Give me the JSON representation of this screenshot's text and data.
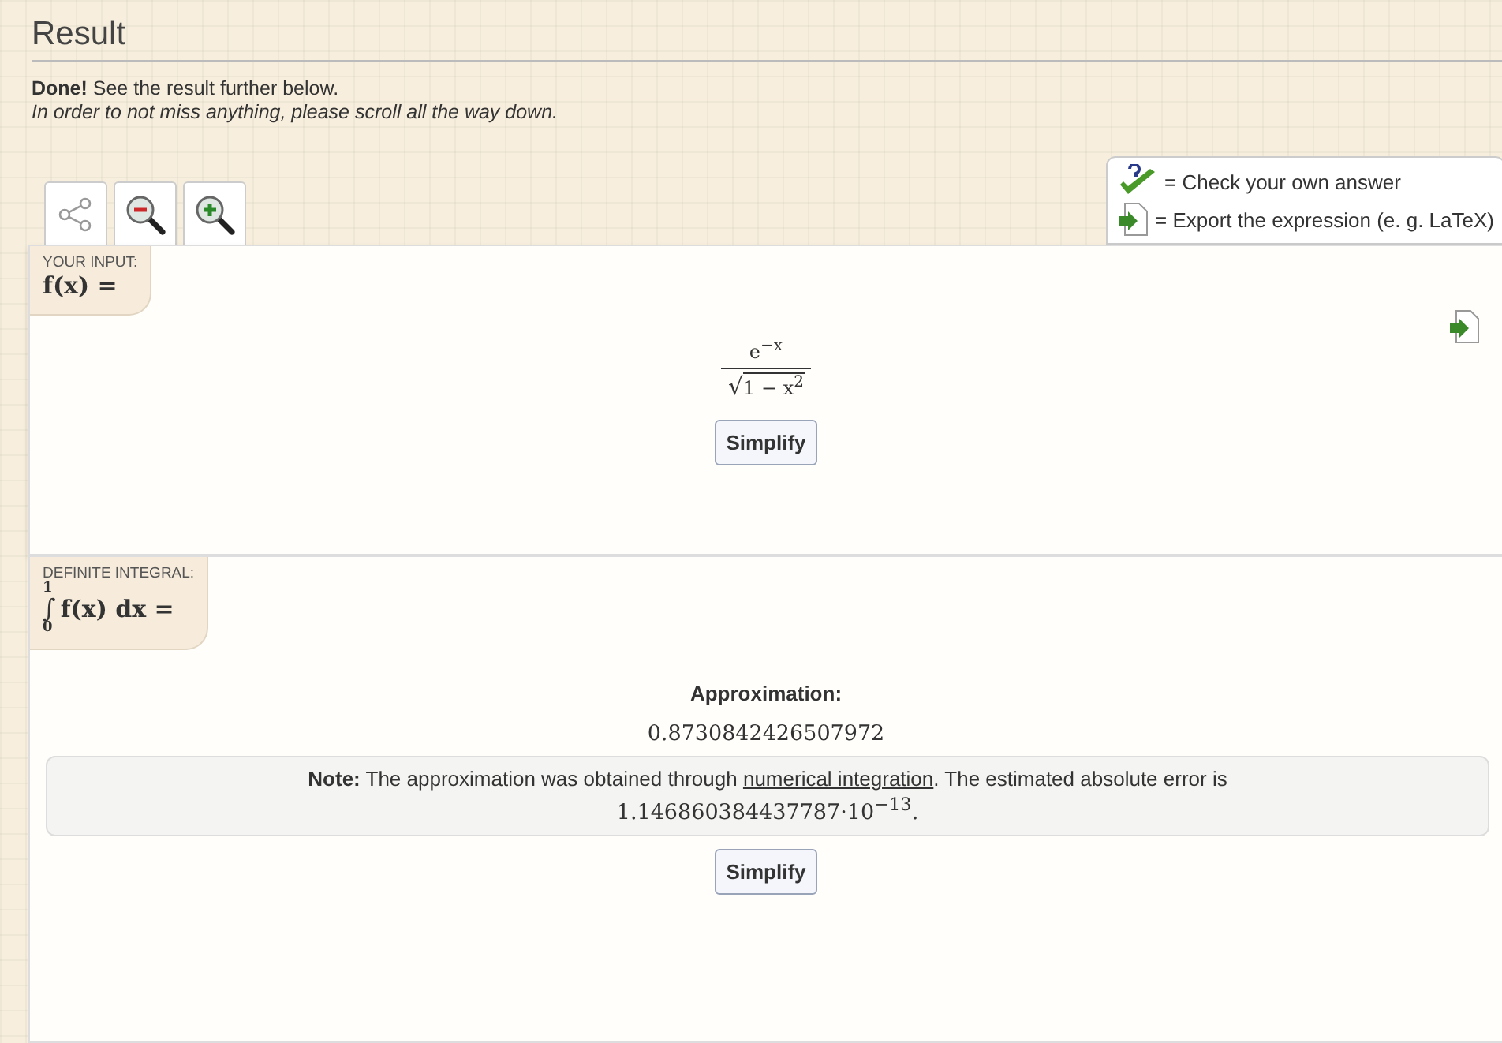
{
  "heading": "Result",
  "status": "**Done!** See the result further below.",
  "hint": "In order to not miss anything, please scroll all the way down.",
  "toolbar": [
    {
      "kind": "share"
    },
    {
      "kind": "zoom-out"
    },
    {
      "kind": "zoom-in"
    }
  ],
  "legend": [
    {
      "kind": "check",
      "text": "= Check your own answer"
    },
    {
      "kind": "export",
      "text": "= Export the expression (e. g. LaTeX)"
    }
  ],
  "input": {
    "label": "YOUR INPUT:",
    "lhs": "f(x) =",
    "numerator": "e$^{−x}$",
    "radical": "√",
    "denominator": "1 − x$^{2}$",
    "button": "Simplify"
  },
  "integral": {
    "label": "DEFINITE INTEGRAL:",
    "upper": "1",
    "sign": "∫",
    "lower": "0",
    "lhs": "f(x) dx =",
    "approx_label": "Approximation:",
    "value": "0.8730842426507972",
    "note": {
      "text": "**Note:** The approximation was obtained through ",
      "link": "numerical integration",
      "rest": ". The estimated absolute error is",
      "error": "1.146860384437787·10$^{−13}$."
    },
    "button": "Simplify"
  }
}
